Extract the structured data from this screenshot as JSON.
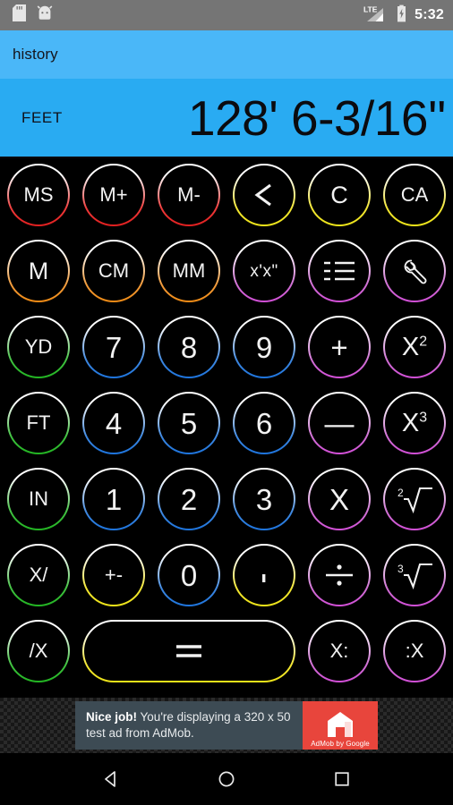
{
  "statusbar": {
    "time": "5:32",
    "icons": [
      "sd-card-icon",
      "android-bug-icon",
      "lte-signal-icon",
      "battery-charging-icon"
    ],
    "network_label": "LTE",
    "background": "#757575"
  },
  "history_bar": {
    "label": "history",
    "background": "#4ab7f8"
  },
  "display": {
    "unit": "FEET",
    "value": "128' 6-3/16''",
    "background": "#29abf2"
  },
  "colors": {
    "memory_red": "#ef3a3a",
    "clear_yellow": "#f2e632",
    "unit_orange": "#f09a3a",
    "tool_purple": "#d06fd4",
    "length_green": "#3fc13f",
    "digit_blue": "#3d87e0",
    "background": "#000000"
  },
  "keypad": {
    "rows": [
      [
        {
          "label": "MS",
          "name": "key-memory-store",
          "color": "g-red",
          "size": "sm"
        },
        {
          "label": "M+",
          "name": "key-memory-add",
          "color": "g-red",
          "size": "sm"
        },
        {
          "label": "M-",
          "name": "key-memory-subtract",
          "color": "g-red",
          "size": "sm"
        },
        {
          "label": "<",
          "name": "key-backspace",
          "color": "g-yellow",
          "size": "big"
        },
        {
          "label": "C",
          "name": "key-clear",
          "color": "g-yellow",
          "size": ""
        },
        {
          "label": "CA",
          "name": "key-clear-all",
          "color": "g-yellow",
          "size": "sm"
        }
      ],
      [
        {
          "label": "M",
          "name": "key-memory-recall",
          "color": "g-orange",
          "size": ""
        },
        {
          "label": "CM",
          "name": "key-centimeters",
          "color": "g-orange",
          "size": "sm"
        },
        {
          "label": "MM",
          "name": "key-millimeters",
          "color": "g-orange",
          "size": "sm"
        },
        {
          "label": "x'x\"",
          "name": "key-feet-inches",
          "color": "g-purple",
          "size": "xs"
        },
        {
          "label": "",
          "name": "key-list-icon",
          "color": "g-purple",
          "size": "",
          "icon": "list-icon"
        },
        {
          "label": "",
          "name": "key-settings",
          "color": "g-purple",
          "size": "",
          "icon": "wrench-icon"
        }
      ],
      [
        {
          "label": "YD",
          "name": "key-yards",
          "color": "g-green",
          "size": "sm"
        },
        {
          "label": "7",
          "name": "key-digit-7",
          "color": "g-blue",
          "size": "big"
        },
        {
          "label": "8",
          "name": "key-digit-8",
          "color": "g-blue",
          "size": "big"
        },
        {
          "label": "9",
          "name": "key-digit-9",
          "color": "g-blue",
          "size": "big"
        },
        {
          "label": "+",
          "name": "key-plus",
          "color": "g-purple",
          "size": "big"
        },
        {
          "label": "",
          "name": "key-square",
          "color": "g-purple",
          "size": "",
          "icon": "x-squared-icon"
        }
      ],
      [
        {
          "label": "FT",
          "name": "key-feet",
          "color": "g-green",
          "size": "sm"
        },
        {
          "label": "4",
          "name": "key-digit-4",
          "color": "g-blue",
          "size": "big"
        },
        {
          "label": "5",
          "name": "key-digit-5",
          "color": "g-blue",
          "size": "big"
        },
        {
          "label": "6",
          "name": "key-digit-6",
          "color": "g-blue",
          "size": "big"
        },
        {
          "label": "—",
          "name": "key-minus",
          "color": "g-purple",
          "size": "big"
        },
        {
          "label": "",
          "name": "key-cube",
          "color": "g-purple",
          "size": "",
          "icon": "x-cubed-icon"
        }
      ],
      [
        {
          "label": "IN",
          "name": "key-inches",
          "color": "g-green",
          "size": "sm"
        },
        {
          "label": "1",
          "name": "key-digit-1",
          "color": "g-blue",
          "size": "big"
        },
        {
          "label": "2",
          "name": "key-digit-2",
          "color": "g-blue",
          "size": "big"
        },
        {
          "label": "3",
          "name": "key-digit-3",
          "color": "g-blue",
          "size": "big"
        },
        {
          "label": "X",
          "name": "key-multiply",
          "color": "g-purple",
          "size": "big"
        },
        {
          "label": "",
          "name": "key-sqrt",
          "color": "g-purple",
          "size": "",
          "icon": "square-root-icon"
        }
      ],
      [
        {
          "label": "X/",
          "name": "key-x-slash",
          "color": "g-green",
          "size": "sm"
        },
        {
          "label": "+-",
          "name": "key-sign-toggle",
          "color": "g-yellow",
          "size": "sm"
        },
        {
          "label": "0",
          "name": "key-digit-0",
          "color": "g-blue",
          "size": "big"
        },
        {
          "label": ",",
          "name": "key-decimal-point",
          "color": "g-yellow",
          "size": "big"
        },
        {
          "label": "",
          "name": "key-divide",
          "color": "g-purple",
          "size": "",
          "icon": "divide-icon"
        },
        {
          "label": "",
          "name": "key-cube-root",
          "color": "g-purple",
          "size": "",
          "icon": "cube-root-icon"
        }
      ],
      [
        {
          "label": "/X",
          "name": "key-slash-x",
          "color": "g-green",
          "size": "sm"
        },
        {
          "label": "=",
          "name": "key-equals",
          "color": "g-yellow",
          "size": "big"
        },
        {
          "label": "X:",
          "name": "key-ratio-left",
          "color": "g-purple",
          "size": "sm"
        },
        {
          "label": ":X",
          "name": "key-ratio-right",
          "color": "g-purple",
          "size": "sm"
        }
      ]
    ]
  },
  "ad": {
    "headline": "Nice job!",
    "body": "You're displaying a 320 x 50 test ad from AdMob.",
    "brand": "AdMob by Google",
    "brand_color": "#e8453c"
  },
  "navbar": {
    "back": "back-icon",
    "home": "home-icon",
    "recents": "recents-icon"
  }
}
